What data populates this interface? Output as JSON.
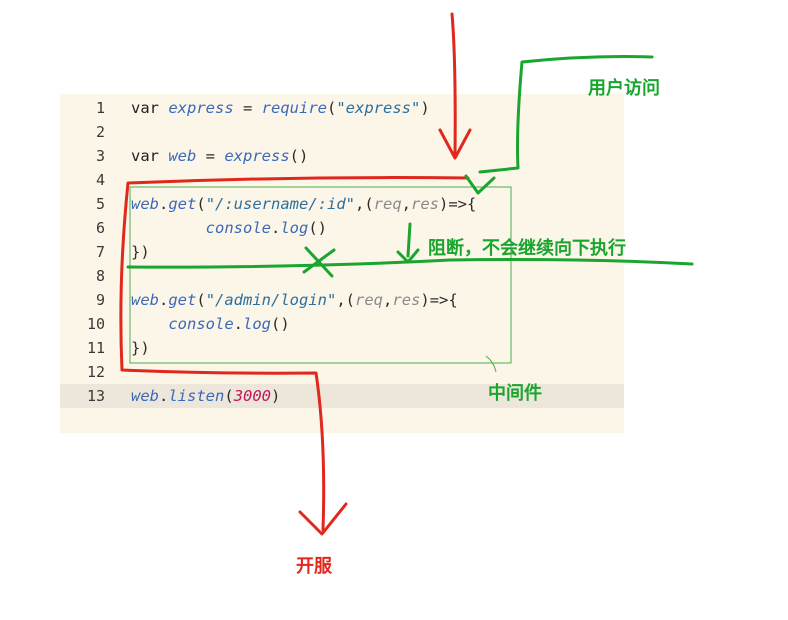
{
  "editor": {
    "lines": [
      {
        "n": "1",
        "tokens": [
          {
            "t": "var",
            "c": "kw"
          },
          {
            "t": " "
          },
          {
            "t": "express",
            "c": "id"
          },
          {
            "t": " = "
          },
          {
            "t": "require",
            "c": "id"
          },
          {
            "t": "("
          },
          {
            "t": "\"express\"",
            "c": "str"
          },
          {
            "t": ")"
          }
        ]
      },
      {
        "n": "2",
        "tokens": []
      },
      {
        "n": "3",
        "tokens": [
          {
            "t": "var",
            "c": "kw"
          },
          {
            "t": " "
          },
          {
            "t": "web",
            "c": "id"
          },
          {
            "t": " = "
          },
          {
            "t": "express",
            "c": "id"
          },
          {
            "t": "()"
          }
        ]
      },
      {
        "n": "4",
        "tokens": []
      },
      {
        "n": "5",
        "tokens": [
          {
            "t": "web",
            "c": "id"
          },
          {
            "t": "."
          },
          {
            "t": "get",
            "c": "id"
          },
          {
            "t": "("
          },
          {
            "t": "\"/:username/:id\"",
            "c": "str"
          },
          {
            "t": ",("
          },
          {
            "t": "req",
            "c": "param"
          },
          {
            "t": ","
          },
          {
            "t": "res",
            "c": "param"
          },
          {
            "t": ")=>{"
          }
        ]
      },
      {
        "n": "6",
        "tokens": [
          {
            "t": "        "
          },
          {
            "t": "console",
            "c": "id"
          },
          {
            "t": "."
          },
          {
            "t": "log",
            "c": "id"
          },
          {
            "t": "()"
          }
        ]
      },
      {
        "n": "7",
        "tokens": [
          {
            "t": "})"
          }
        ]
      },
      {
        "n": "8",
        "tokens": []
      },
      {
        "n": "9",
        "tokens": [
          {
            "t": "web",
            "c": "id"
          },
          {
            "t": "."
          },
          {
            "t": "get",
            "c": "id"
          },
          {
            "t": "("
          },
          {
            "t": "\"/admin/login\"",
            "c": "str"
          },
          {
            "t": ",("
          },
          {
            "t": "req",
            "c": "param"
          },
          {
            "t": ","
          },
          {
            "t": "res",
            "c": "param"
          },
          {
            "t": ")=>{"
          }
        ]
      },
      {
        "n": "10",
        "tokens": [
          {
            "t": "    "
          },
          {
            "t": "console",
            "c": "id"
          },
          {
            "t": "."
          },
          {
            "t": "log",
            "c": "id"
          },
          {
            "t": "()"
          }
        ]
      },
      {
        "n": "11",
        "tokens": [
          {
            "t": "})"
          }
        ]
      },
      {
        "n": "12",
        "tokens": []
      },
      {
        "n": "13",
        "tokens": [
          {
            "t": "web",
            "c": "id"
          },
          {
            "t": "."
          },
          {
            "t": "listen",
            "c": "id"
          },
          {
            "t": "("
          },
          {
            "t": "3000",
            "c": "num"
          },
          {
            "t": ")"
          }
        ]
      }
    ]
  },
  "annotations": {
    "user_access": "用户访问",
    "blocked": "阻断，不会继续向下执行",
    "middleware": "中间件",
    "start_server": "开服"
  },
  "colors": {
    "red": "#e0281d",
    "green": "#1aa52f",
    "box": "#4caf50",
    "editor_bg": "#fcf6e9"
  }
}
